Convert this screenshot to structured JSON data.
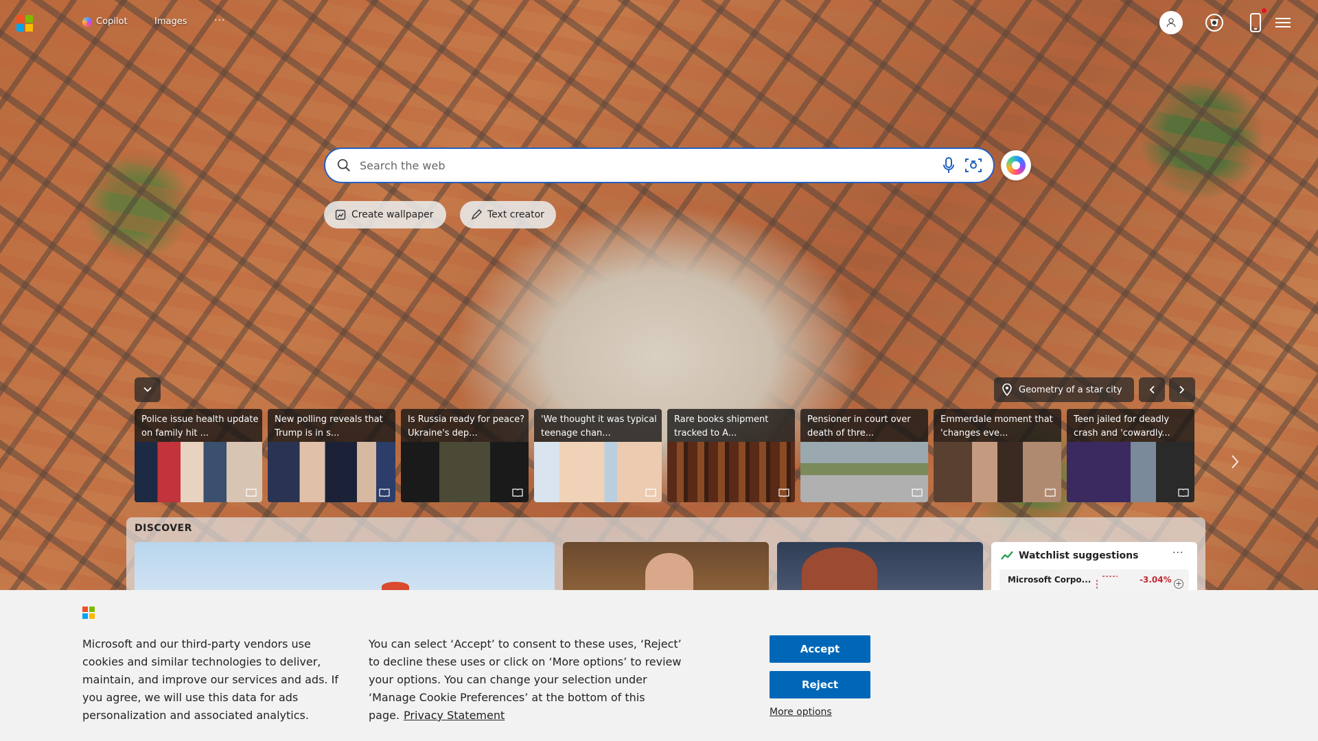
{
  "header": {
    "nav": [
      {
        "label": "Copilot",
        "icon": "copilot-icon"
      },
      {
        "label": "Images"
      }
    ],
    "more_label": "···",
    "icons": [
      "avatar",
      "rewards-icon",
      "phone-icon",
      "menu-icon"
    ],
    "brand_colors": {
      "red": "#f25022",
      "green": "#7fba00",
      "blue": "#00a4ef",
      "yellow": "#ffb900"
    }
  },
  "search": {
    "placeholder": "Search the web",
    "value": ""
  },
  "quick_actions": [
    {
      "label": "Create wallpaper",
      "icon": "wallpaper-icon"
    },
    {
      "label": "Text creator",
      "icon": "pen-icon"
    }
  ],
  "background_info": {
    "label": "Geometry of a star city",
    "icon": "location-pin-icon"
  },
  "news": [
    {
      "title": "Police issue health update on family hit ..."
    },
    {
      "title": "New polling reveals that Trump is in s..."
    },
    {
      "title": "Is Russia ready for peace? Ukraine's dep..."
    },
    {
      "title": "'We thought it was typical teenage chan..."
    },
    {
      "title": "Rare books shipment tracked to A..."
    },
    {
      "title": "Pensioner in court over death of thre..."
    },
    {
      "title": "Emmerdale moment that 'changes eve..."
    },
    {
      "title": "Teen jailed for deadly crash and 'cowardly..."
    }
  ],
  "discover": {
    "label": "DISCOVER",
    "watchlist": {
      "title": "Watchlist suggestions",
      "more_label": "···",
      "stock_name": "Microsoft Corpo...",
      "stock_change": "-3.04%",
      "add_label": "+"
    }
  },
  "cookie": {
    "text1": "Microsoft and our third-party vendors use cookies and similar technologies to deliver, maintain, and improve our services and ads. If you agree, we will use this data for ads personalization and associated analytics.",
    "text2": "You can select ‘Accept’ to consent to these uses, ‘Reject’ to decline these uses or click on ‘More options’ to review your options. You can change your selection under ‘Manage Cookie Preferences’ at the bottom of this page.",
    "privacy_link": "Privacy Statement",
    "accept": "Accept",
    "reject": "Reject",
    "more_options": "More options",
    "accent_color": "#0067b8"
  }
}
